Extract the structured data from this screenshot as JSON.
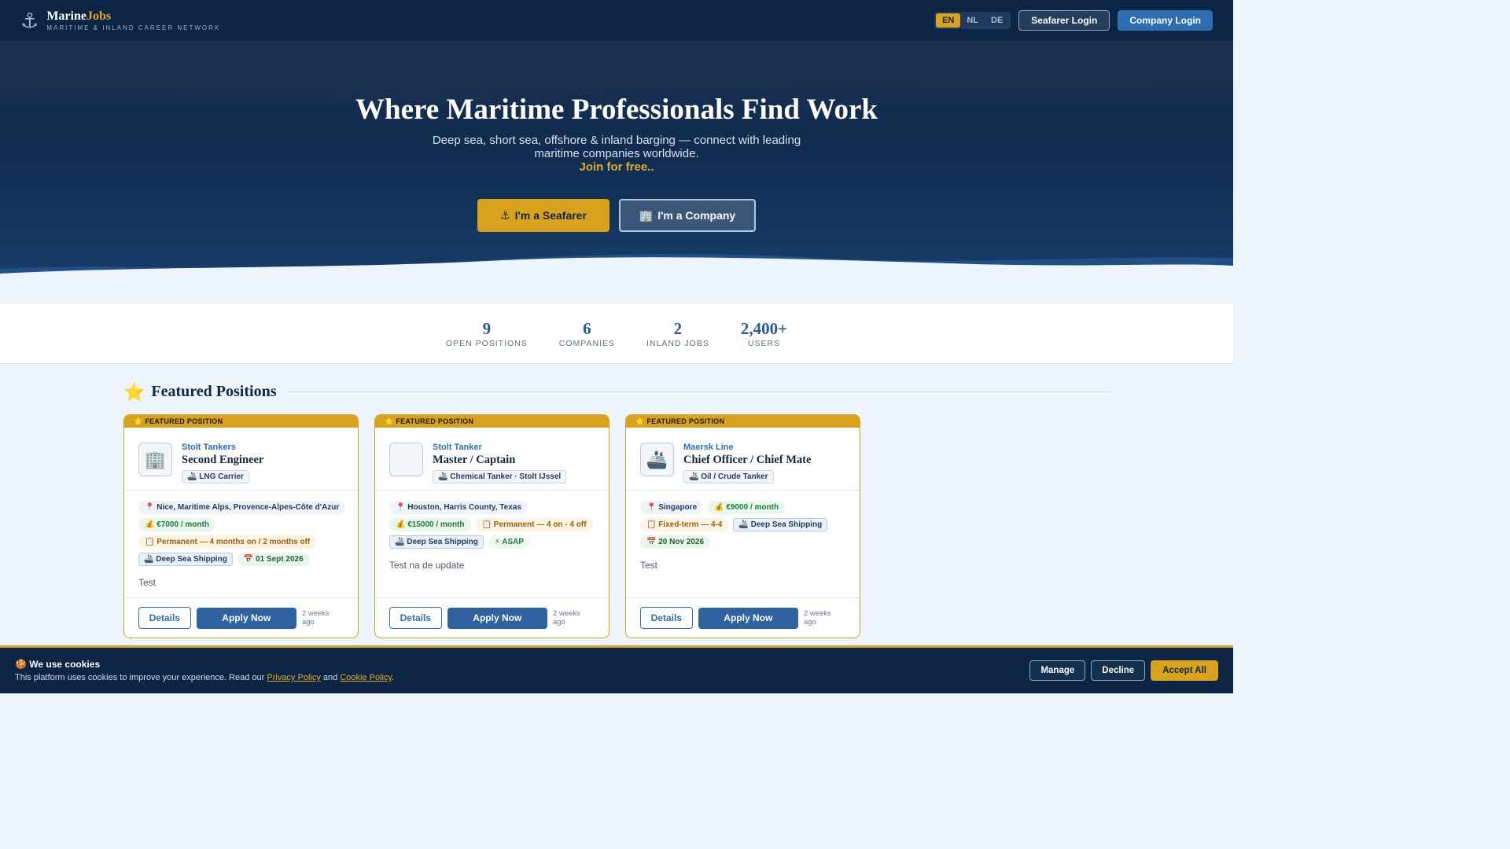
{
  "header": {
    "logo_icon": "anchor-icon",
    "brand_part1": "Marine",
    "brand_part2": "Jobs",
    "tagline": "MARITIME & INLAND CAREER NETWORK",
    "languages": [
      "EN",
      "NL",
      "DE"
    ],
    "active_language": "EN",
    "seafarer_login": "Seafarer Login",
    "company_login": "Company Login"
  },
  "hero": {
    "title": "Where Maritime Professionals Find Work",
    "subtitle": "Deep sea, short sea, offshore & inland barging — connect with leading maritime companies worldwide.",
    "join": "Join for free..",
    "seafarer_button": "I'm a Seafarer",
    "company_button": "I'm a Company"
  },
  "stats": [
    {
      "value": "9",
      "label": "OPEN POSITIONS"
    },
    {
      "value": "6",
      "label": "COMPANIES"
    },
    {
      "value": "2",
      "label": "INLAND JOBS"
    },
    {
      "value": "2,400+",
      "label": "USERS"
    }
  ],
  "featured": {
    "title": "Featured Positions",
    "ribbon": "FEATURED POSITION",
    "details_label": "Details",
    "apply_label": "Apply Now",
    "cards": [
      {
        "company": "Stolt Tankers",
        "role": "Second Engineer",
        "logo_icon": "building-icon",
        "vessel": "LNG Carrier",
        "location": "Nice, Maritime Alps, Provence-Alpes-Côte d'Azur",
        "salary": "€7000 / month",
        "contract": "Permanent — 4 months on / 2 months off",
        "sector": "Deep Sea Shipping",
        "start": "01 Sept 2026",
        "description": "Test",
        "posted": "2 weeks ago"
      },
      {
        "company": "Stolt Tanker",
        "role": "Master / Captain",
        "logo_icon": "blank-logo",
        "vessel": "Chemical Tanker · Stolt IJssel",
        "location": "Houston, Harris County, Texas",
        "salary": "€15000 / month",
        "contract": "Permanent — 4 on - 4 off",
        "sector": "Deep Sea Shipping",
        "start": "ASAP",
        "description": "Test na de update",
        "posted": "2 weeks ago"
      },
      {
        "company": "Maersk Line",
        "role": "Chief Officer / Chief Mate",
        "logo_icon": "ship-icon",
        "vessel": "Oil / Crude Tanker",
        "location": "Singapore",
        "salary": "€9000 / month",
        "contract": "Fixed-term — 4-4",
        "sector": "Deep Sea Shipping",
        "start": "20 Nov 2026",
        "description": "Test",
        "posted": "2 weeks ago"
      }
    ]
  },
  "cookie": {
    "title": "We use cookies",
    "message_before": "This platform uses cookies to improve your experience. Read our ",
    "privacy_link": "Privacy Policy",
    "message_and": " and ",
    "cookie_link": "Cookie Policy",
    "message_end": ".",
    "manage": "Manage",
    "decline": "Decline",
    "accept": "Accept All"
  },
  "colors": {
    "navy": "#0d2544",
    "gold": "#d9a21d",
    "blue": "#2f6db3"
  }
}
